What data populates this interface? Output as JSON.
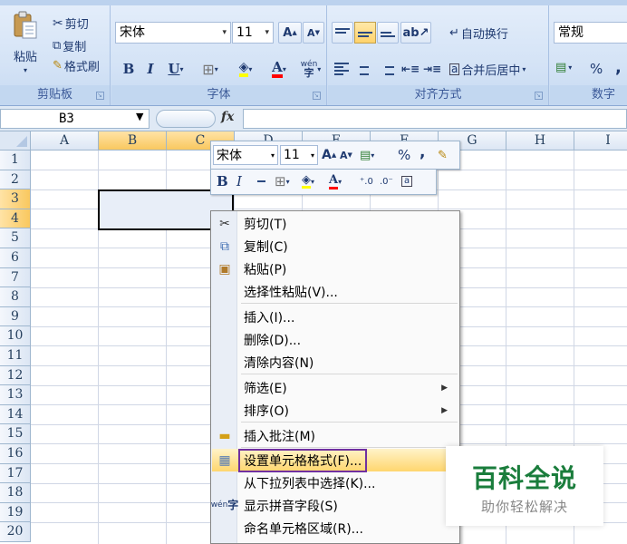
{
  "ribbon": {
    "clipboard": {
      "paste_label": "粘贴",
      "cut_label": "剪切",
      "copy_label": "复制",
      "format_painter_label": "格式刷",
      "group_label": "剪贴板"
    },
    "font": {
      "font_name": "宋体",
      "font_size": "11",
      "group_label": "字体",
      "bold": "B",
      "italic": "I",
      "underline": "U",
      "phonetic": "wén"
    },
    "alignment": {
      "wrap_text_label": "自动换行",
      "merge_center_label": "合并后居中",
      "group_label": "对齐方式"
    },
    "number": {
      "format_value": "常规",
      "percent": "%",
      "comma": ",",
      "group_label": "数字"
    }
  },
  "formula_bar": {
    "name_box": "B3",
    "fx": "fx",
    "value": ""
  },
  "grid": {
    "columns": [
      "A",
      "B",
      "C",
      "D",
      "E",
      "F",
      "G",
      "H",
      "I"
    ],
    "rows": [
      "1",
      "2",
      "3",
      "4",
      "5",
      "6",
      "7",
      "8",
      "9",
      "10",
      "11",
      "12",
      "13",
      "14",
      "15",
      "16",
      "17",
      "18",
      "19",
      "20"
    ],
    "selected_range": "B3:C4"
  },
  "mini_toolbar": {
    "font_name": "宋体",
    "font_size": "11",
    "percent": "%",
    "comma": ",",
    "bold": "B",
    "italic": "I"
  },
  "context_menu": {
    "items": [
      {
        "label": "剪切(T)",
        "icon": "scissors-icon"
      },
      {
        "label": "复制(C)",
        "icon": "copy-icon"
      },
      {
        "label": "粘贴(P)",
        "icon": "paste-icon"
      },
      {
        "label": "选择性粘贴(V)...",
        "icon": ""
      },
      {
        "label": "插入(I)...",
        "icon": ""
      },
      {
        "label": "删除(D)...",
        "icon": ""
      },
      {
        "label": "清除内容(N)",
        "icon": ""
      },
      {
        "label": "筛选(E)",
        "icon": "",
        "submenu": true
      },
      {
        "label": "排序(O)",
        "icon": "",
        "submenu": true
      },
      {
        "label": "插入批注(M)",
        "icon": "comment-icon"
      },
      {
        "label": "设置单元格格式(F)...",
        "icon": "format-cells-icon",
        "highlighted": true
      },
      {
        "label": "从下拉列表中选择(K)...",
        "icon": ""
      },
      {
        "label": "显示拼音字段(S)",
        "icon": "phonetic-icon"
      },
      {
        "label": "命名单元格区域(R)...",
        "icon": ""
      }
    ]
  },
  "watermark": {
    "title": "百科全说",
    "subtitle": "助你轻松解决"
  },
  "colors": {
    "ribbon_bg": "#d4e3f6",
    "highlight_outline": "#7030a0",
    "watermark_green": "#1a7d3c",
    "selection_header": "#f9c85f"
  }
}
